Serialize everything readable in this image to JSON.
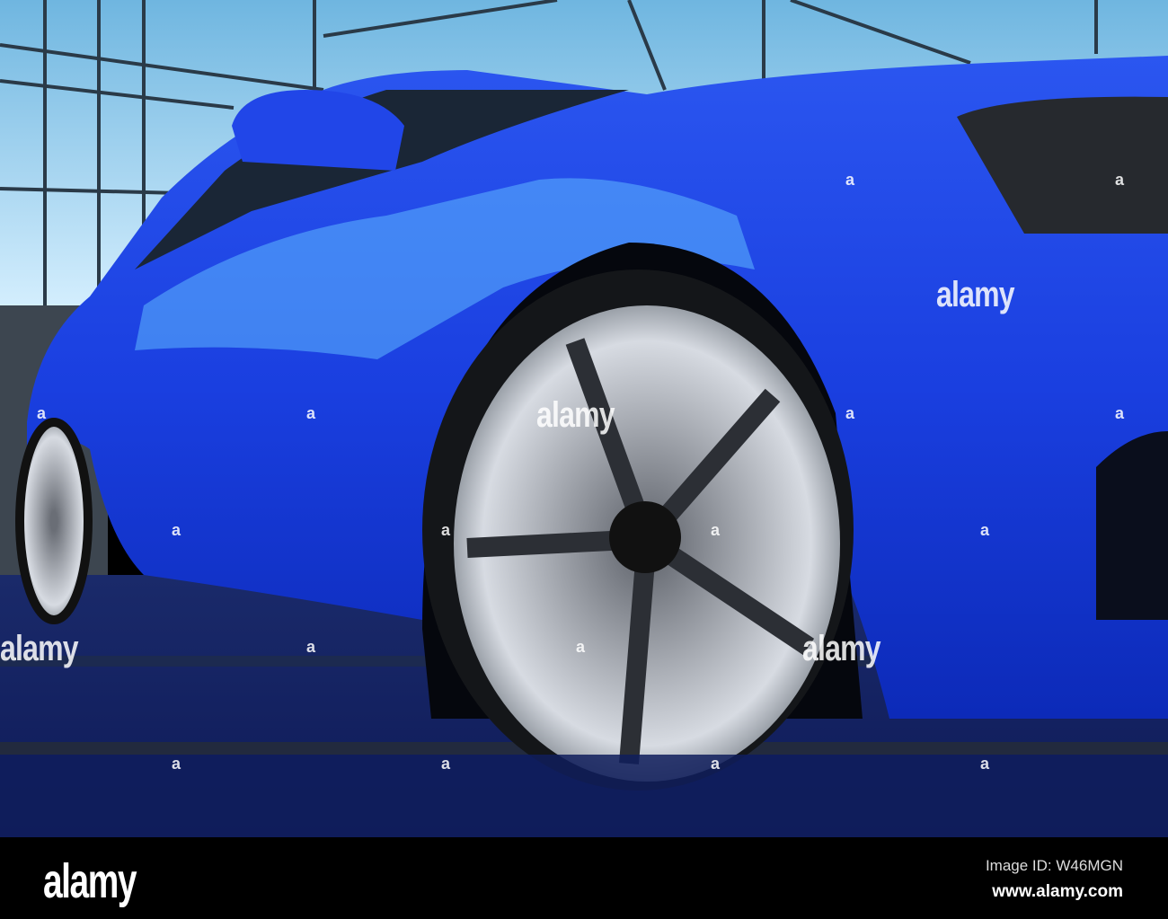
{
  "photo": {
    "subject": "Blue sports car",
    "colors": {
      "body": "#1a3fe0",
      "highlight": "#5fb8ff",
      "floor": "#0f1d5c",
      "glass": "#bfe6ff",
      "wheel": "#c8ccd3"
    }
  },
  "watermark": {
    "large_text": "alamy",
    "small_text": "a"
  },
  "footer": {
    "logo": "alamy",
    "image_id": "Image ID: W46MGN",
    "url": "www.alamy.com"
  }
}
